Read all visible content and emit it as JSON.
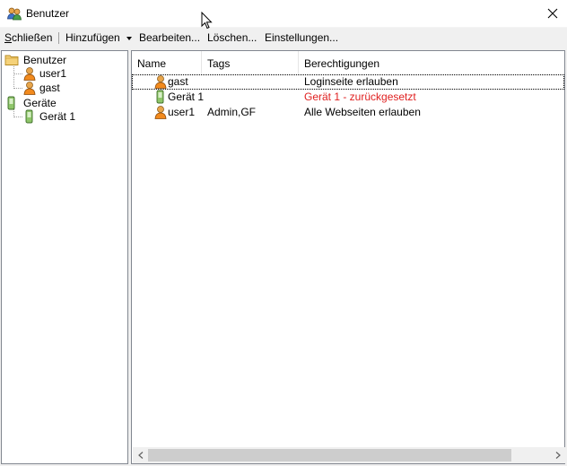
{
  "window": {
    "title": "Benutzer",
    "close_glyph": "✕"
  },
  "menu": {
    "schliessen": "Schließen",
    "hinzufuegen": "Hinzufügen",
    "bearbeiten": "Bearbeiten...",
    "loeschen": "Löschen...",
    "einstellungen": "Einstellungen..."
  },
  "tree": {
    "users_folder": "Benutzer",
    "users": [
      "user1",
      "gast"
    ],
    "devices_folder": "Geräte",
    "devices": [
      "Gerät 1"
    ]
  },
  "list": {
    "columns": [
      "Name",
      "Tags",
      "Berechtigungen"
    ],
    "rows": [
      {
        "icon": "user-icon",
        "name": "gast",
        "tags": "",
        "permissions": "Loginseite erlauben",
        "permissions_color": "#000000"
      },
      {
        "icon": "device-icon",
        "name": "Gerät 1",
        "tags": "",
        "permissions": "Gerät 1 - zurückgesetzt",
        "permissions_color": "#e02020"
      },
      {
        "icon": "user-icon",
        "name": "user1",
        "tags": "Admin,GF",
        "permissions": "Alle Webseiten erlauben",
        "permissions_color": "#000000"
      }
    ]
  },
  "colors": {
    "warning_text": "#e02020",
    "folder": "#f5d27a",
    "device": "#8fc66a"
  }
}
